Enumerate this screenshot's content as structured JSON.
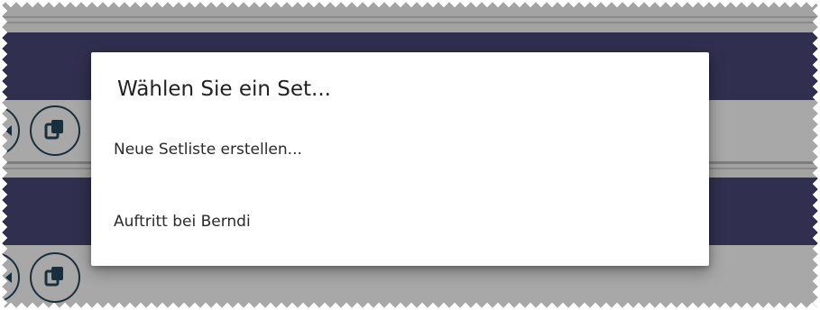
{
  "dialog": {
    "title": "Wählen Sie ein Set...",
    "items": [
      {
        "label": "Neue Setliste erstellen..."
      },
      {
        "label": "Auftritt bei Berndi"
      }
    ]
  },
  "background": {
    "rows": [
      {
        "icon": "copy-icon"
      },
      {
        "icon": "copy-icon"
      }
    ]
  },
  "colors": {
    "band": "#312f4f",
    "scrim_gray": "#a3a3a3",
    "icon_dark": "#18303d",
    "dialog_bg": "#ffffff"
  }
}
